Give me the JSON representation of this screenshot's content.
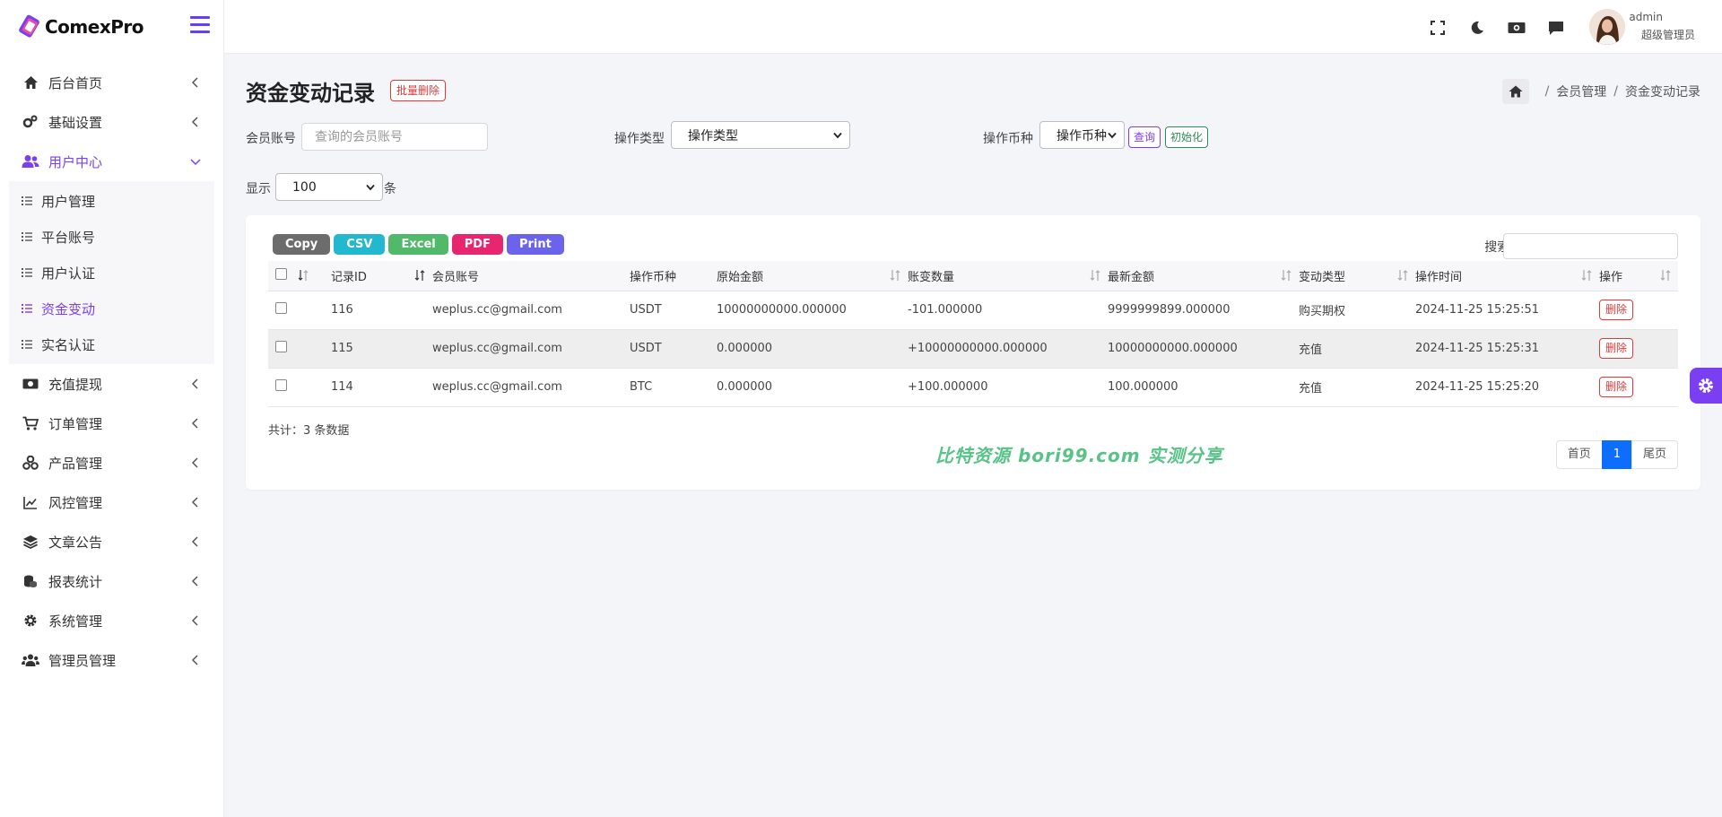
{
  "app": {
    "name": "ComexPro"
  },
  "colors": {
    "accent": "#7b3ff2",
    "danger": "#e03a3a",
    "success": "#2e8b57",
    "primary": "#0d6efd"
  },
  "sidebar": {
    "items": [
      {
        "label": "后台首页",
        "icon": "home-icon"
      },
      {
        "label": "基础设置",
        "icon": "gears-icon"
      },
      {
        "label": "用户中心",
        "icon": "users-icon",
        "active": true
      },
      {
        "label": "充值提现",
        "icon": "money-icon"
      },
      {
        "label": "订单管理",
        "icon": "cart-icon"
      },
      {
        "label": "产品管理",
        "icon": "cubes-icon"
      },
      {
        "label": "风控管理",
        "icon": "chart-line-icon"
      },
      {
        "label": "文章公告",
        "icon": "layers-icon"
      },
      {
        "label": "报表统计",
        "icon": "coins-icon"
      },
      {
        "label": "系统管理",
        "icon": "gear-icon"
      },
      {
        "label": "管理员管理",
        "icon": "user-group-icon"
      }
    ],
    "submenu": [
      {
        "label": "用户管理"
      },
      {
        "label": "平台账号"
      },
      {
        "label": "用户认证"
      },
      {
        "label": "资金变动",
        "active": true
      },
      {
        "label": "实名认证"
      }
    ]
  },
  "header": {
    "user_name": "admin",
    "user_role": "超级管理员"
  },
  "page": {
    "title": "资金变动记录",
    "batch_delete": "批量删除",
    "breadcrumb": [
      "会员管理",
      "资金变动记录"
    ],
    "breadcrumb_sep": "/"
  },
  "filters": {
    "member_label": "会员账号",
    "member_placeholder": "查询的会员账号",
    "op_type_label": "操作类型",
    "op_type_value": "操作类型",
    "currency_label": "操作币种",
    "currency_value": "操作币种",
    "query_btn": "查询",
    "reset_btn": "初始化",
    "show_label": "显示",
    "show_value": "100",
    "show_unit": "条"
  },
  "toolbar": {
    "buttons": [
      {
        "label": "Copy",
        "color": "#6c6c6c"
      },
      {
        "label": "CSV",
        "color": "#22b8cf"
      },
      {
        "label": "Excel",
        "color": "#51b96a"
      },
      {
        "label": "PDF",
        "color": "#e8266f"
      },
      {
        "label": "Print",
        "color": "#6b63e9"
      }
    ],
    "search_label": "搜索:"
  },
  "table": {
    "headers": [
      "记录ID",
      "会员账号",
      "操作币种",
      "原始金额",
      "账变数量",
      "最新金额",
      "变动类型",
      "操作时间",
      "操作"
    ],
    "rows": [
      {
        "id": "116",
        "account": "weplus.cc@gmail.com",
        "currency": "USDT",
        "original": "10000000000.000000",
        "change": "-101.000000",
        "change_type": "neg",
        "latest": "9999999899.000000",
        "kind": "购买期权",
        "time": "2024-11-25 15:25:51",
        "action": "删除"
      },
      {
        "id": "115",
        "account": "weplus.cc@gmail.com",
        "currency": "USDT",
        "original": "0.000000",
        "change": "+10000000000.000000",
        "change_type": "pos",
        "latest": "10000000000.000000",
        "kind": "充值",
        "time": "2024-11-25 15:25:31",
        "action": "删除"
      },
      {
        "id": "114",
        "account": "weplus.cc@gmail.com",
        "currency": "BTC",
        "original": "0.000000",
        "change": "+100.000000",
        "change_type": "pos",
        "latest": "100.000000",
        "kind": "充值",
        "time": "2024-11-25 15:25:20",
        "action": "删除"
      }
    ],
    "total": "共计：3 条数据"
  },
  "pagination": {
    "first": "首页",
    "current": "1",
    "last": "尾页"
  },
  "watermark": "比特资源 bori99.com 实测分享"
}
